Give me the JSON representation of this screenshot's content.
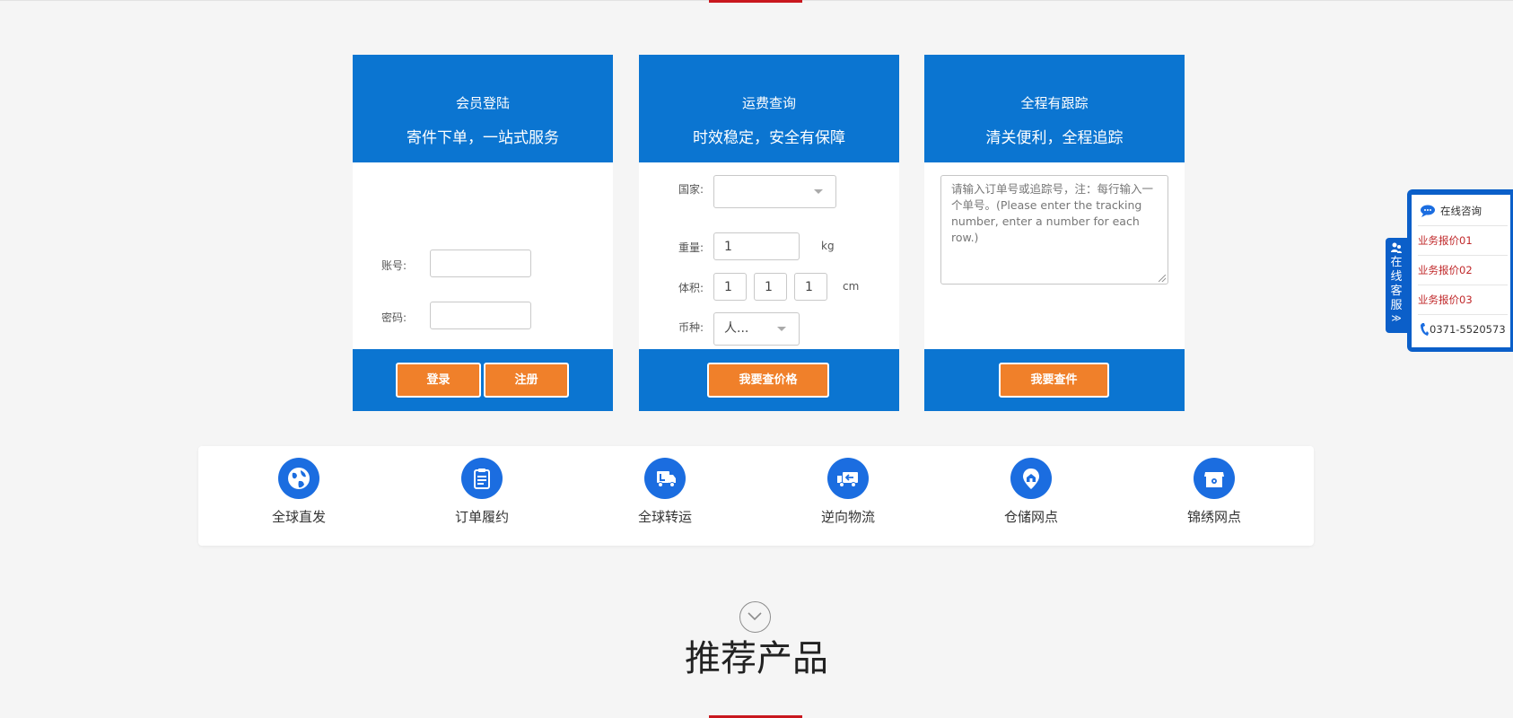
{
  "login_card": {
    "title": "会员登陆",
    "subtitle": "寄件下单，一站式服务",
    "account_label": "账号:",
    "password_label": "密码:",
    "account_value": "",
    "password_value": "",
    "login_button": "登录",
    "register_button": "注册"
  },
  "freight_card": {
    "title": "运费查询",
    "subtitle": "时效稳定，安全有保障",
    "country_label": "国家:",
    "country_value": "",
    "weight_label": "重量:",
    "weight_value": "1",
    "weight_unit": "kg",
    "volume_label": "体积:",
    "volume_values": [
      "1",
      "1",
      "1"
    ],
    "volume_unit": "cm",
    "currency_label": "币种:",
    "currency_value": "人...",
    "query_button": "我要查价格"
  },
  "tracking_card": {
    "title": "全程有跟踪",
    "subtitle": "清关便利，全程追踪",
    "placeholder": "请输入订单号或追踪号，注：每行输入一个单号。(Please enter the tracking number, enter a number for each row.)",
    "query_button": "我要查件"
  },
  "features": [
    {
      "label": "全球直发",
      "icon": "globe-icon"
    },
    {
      "label": "订单履约",
      "icon": "clipboard-icon"
    },
    {
      "label": "全球转运",
      "icon": "truck-icon"
    },
    {
      "label": "逆向物流",
      "icon": "reverse-truck-icon"
    },
    {
      "label": "仓储网点",
      "icon": "warehouse-location-icon"
    },
    {
      "label": "锦绣网点",
      "icon": "store-icon"
    }
  ],
  "section": {
    "title": "推荐产品"
  },
  "side_service": {
    "tab_label": "在线客服",
    "tab_arrow": "≫",
    "consult_label": "在线咨询",
    "items": [
      "业务报价01",
      "业务报价02",
      "业务报价03"
    ],
    "phone": "0371-5520573"
  },
  "colors": {
    "primary_blue": "#0b75d1",
    "button_orange": "#f0802a",
    "accent_red": "#c9171e",
    "icon_blue": "#1b6de0"
  }
}
